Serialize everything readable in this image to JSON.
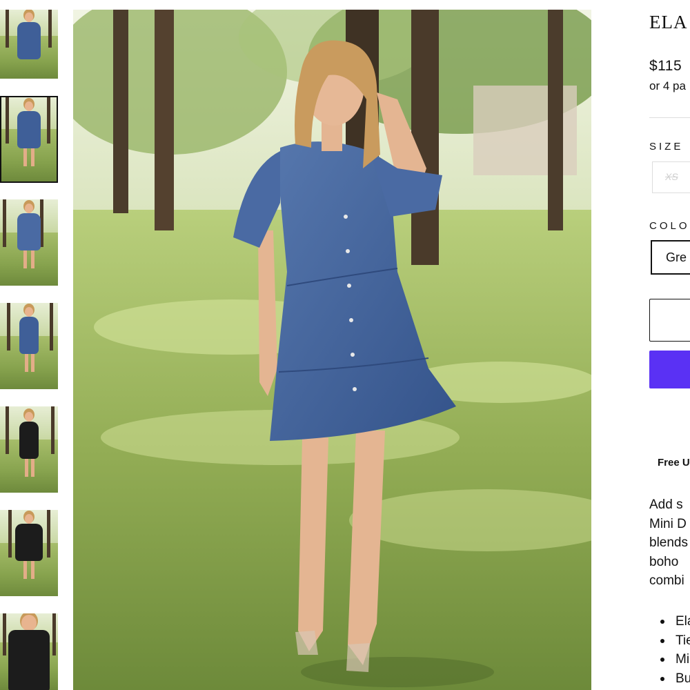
{
  "gallery": {
    "thumbnails": [
      {
        "alt": "blue dress front",
        "dress_color": "#3f5f98"
      },
      {
        "alt": "blue dress full",
        "dress_color": "#3f5f98"
      },
      {
        "alt": "blue dress side",
        "dress_color": "#4a6aa3"
      },
      {
        "alt": "blue dress walking",
        "dress_color": "#3f5f98"
      },
      {
        "alt": "black dress front",
        "dress_color": "#1c1c1c"
      },
      {
        "alt": "black dress pose",
        "dress_color": "#1c1c1c"
      },
      {
        "alt": "black dress close",
        "dress_color": "#1c1c1c"
      }
    ],
    "active_index": 1
  },
  "product": {
    "title": "ELA",
    "price": "$115",
    "installments": "or 4 pa",
    "size_label": "SIZE",
    "sizes": [
      {
        "label": "XS",
        "available": false
      }
    ],
    "color_label": "COLO",
    "selected_color": "Gre",
    "shipping": "Free U",
    "description": [
      "Add s",
      "Mini D",
      "blends",
      "boho",
      "combi"
    ],
    "features": [
      "Ela",
      "Tie",
      "Mi",
      "Bu"
    ]
  },
  "colors": {
    "buy_button": "#5a31f4",
    "selected_border": "#111111",
    "dress_denim": "#3f5f98"
  }
}
